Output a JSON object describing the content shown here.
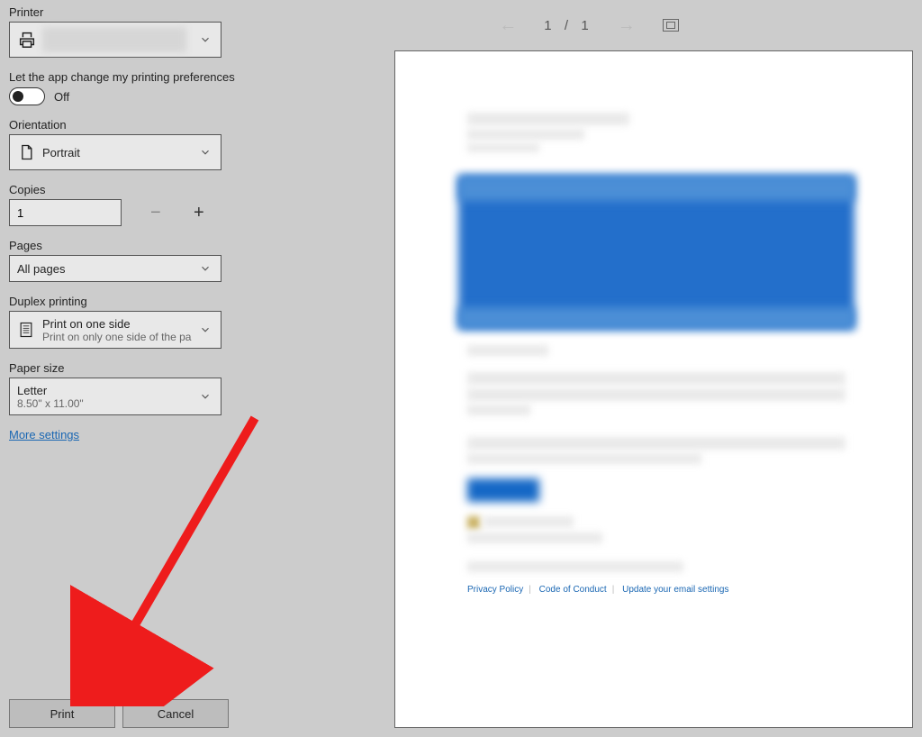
{
  "panel": {
    "printer_label": "Printer",
    "printer_name_redacted": "",
    "app_change_label": "Let the app change my printing preferences",
    "app_change_state": "Off",
    "orientation_label": "Orientation",
    "orientation_value": "Portrait",
    "copies_label": "Copies",
    "copies_value": "1",
    "minus_glyph": "−",
    "plus_glyph": "+",
    "pages_label": "Pages",
    "pages_value": "All pages",
    "duplex_label": "Duplex printing",
    "duplex_value_main": "Print on one side",
    "duplex_value_sub": "Print on only one side of the pa",
    "paper_label": "Paper size",
    "paper_value_main": "Letter",
    "paper_value_sub": "8.50\" x 11.00\"",
    "more_settings": "More settings"
  },
  "footer": {
    "print": "Print",
    "cancel": "Cancel"
  },
  "preview": {
    "page_current": "1",
    "page_sep": "/",
    "page_total": "1",
    "links": {
      "a": "Privacy Policy",
      "b": "Code of Conduct",
      "c": "Update your email settings"
    }
  }
}
